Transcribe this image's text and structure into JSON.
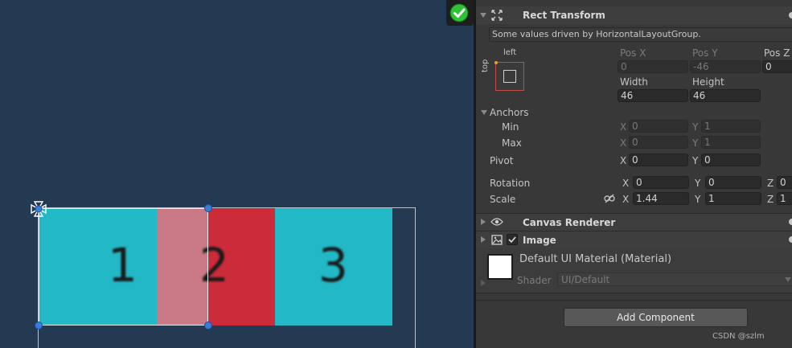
{
  "scene": {
    "cells": [
      {
        "label": "1",
        "color": "#23b8c6"
      },
      {
        "label": "2",
        "color": "#c9757f",
        "overlap_color": "#cc2b3a"
      },
      {
        "label": "3",
        "color": "#23b8c6"
      }
    ],
    "background": "#243952",
    "handle_color": "#3b7cd6",
    "check_icon": "green-check-circle-icon"
  },
  "inspector": {
    "rect_transform": {
      "title": "Rect Transform",
      "info": "Some values driven by HorizontalLayoutGroup.",
      "anchor_preset": {
        "horizontal": "left",
        "vertical": "top"
      },
      "pos_x_label": "Pos X",
      "pos_y_label": "Pos Y",
      "pos_z_label": "Pos Z",
      "pos_x": "0",
      "pos_y": "-46",
      "pos_z": "0",
      "width_label": "Width",
      "height_label": "Height",
      "width": "46",
      "height": "46",
      "anchors_label": "Anchors",
      "min_label": "Min",
      "max_label": "Max",
      "min_x": "0",
      "min_y": "1",
      "max_x": "0",
      "max_y": "1",
      "pivot_label": "Pivot",
      "pivot_x": "0",
      "pivot_y": "0",
      "rotation_label": "Rotation",
      "rot_x": "0",
      "rot_y": "0",
      "rot_z": "0",
      "scale_label": "Scale",
      "scale_x": "1.44",
      "scale_y": "1",
      "scale_z": "1",
      "axis_x": "X",
      "axis_y": "Y",
      "axis_z": "Z"
    },
    "canvas_renderer": {
      "title": "Canvas Renderer"
    },
    "image": {
      "title": "Image",
      "enabled": true
    },
    "material": {
      "name": "Default UI Material (Material)",
      "shader_label": "Shader",
      "shader_value": "UI/Default"
    },
    "add_component": "Add Component",
    "watermark": "CSDN @szlm"
  }
}
